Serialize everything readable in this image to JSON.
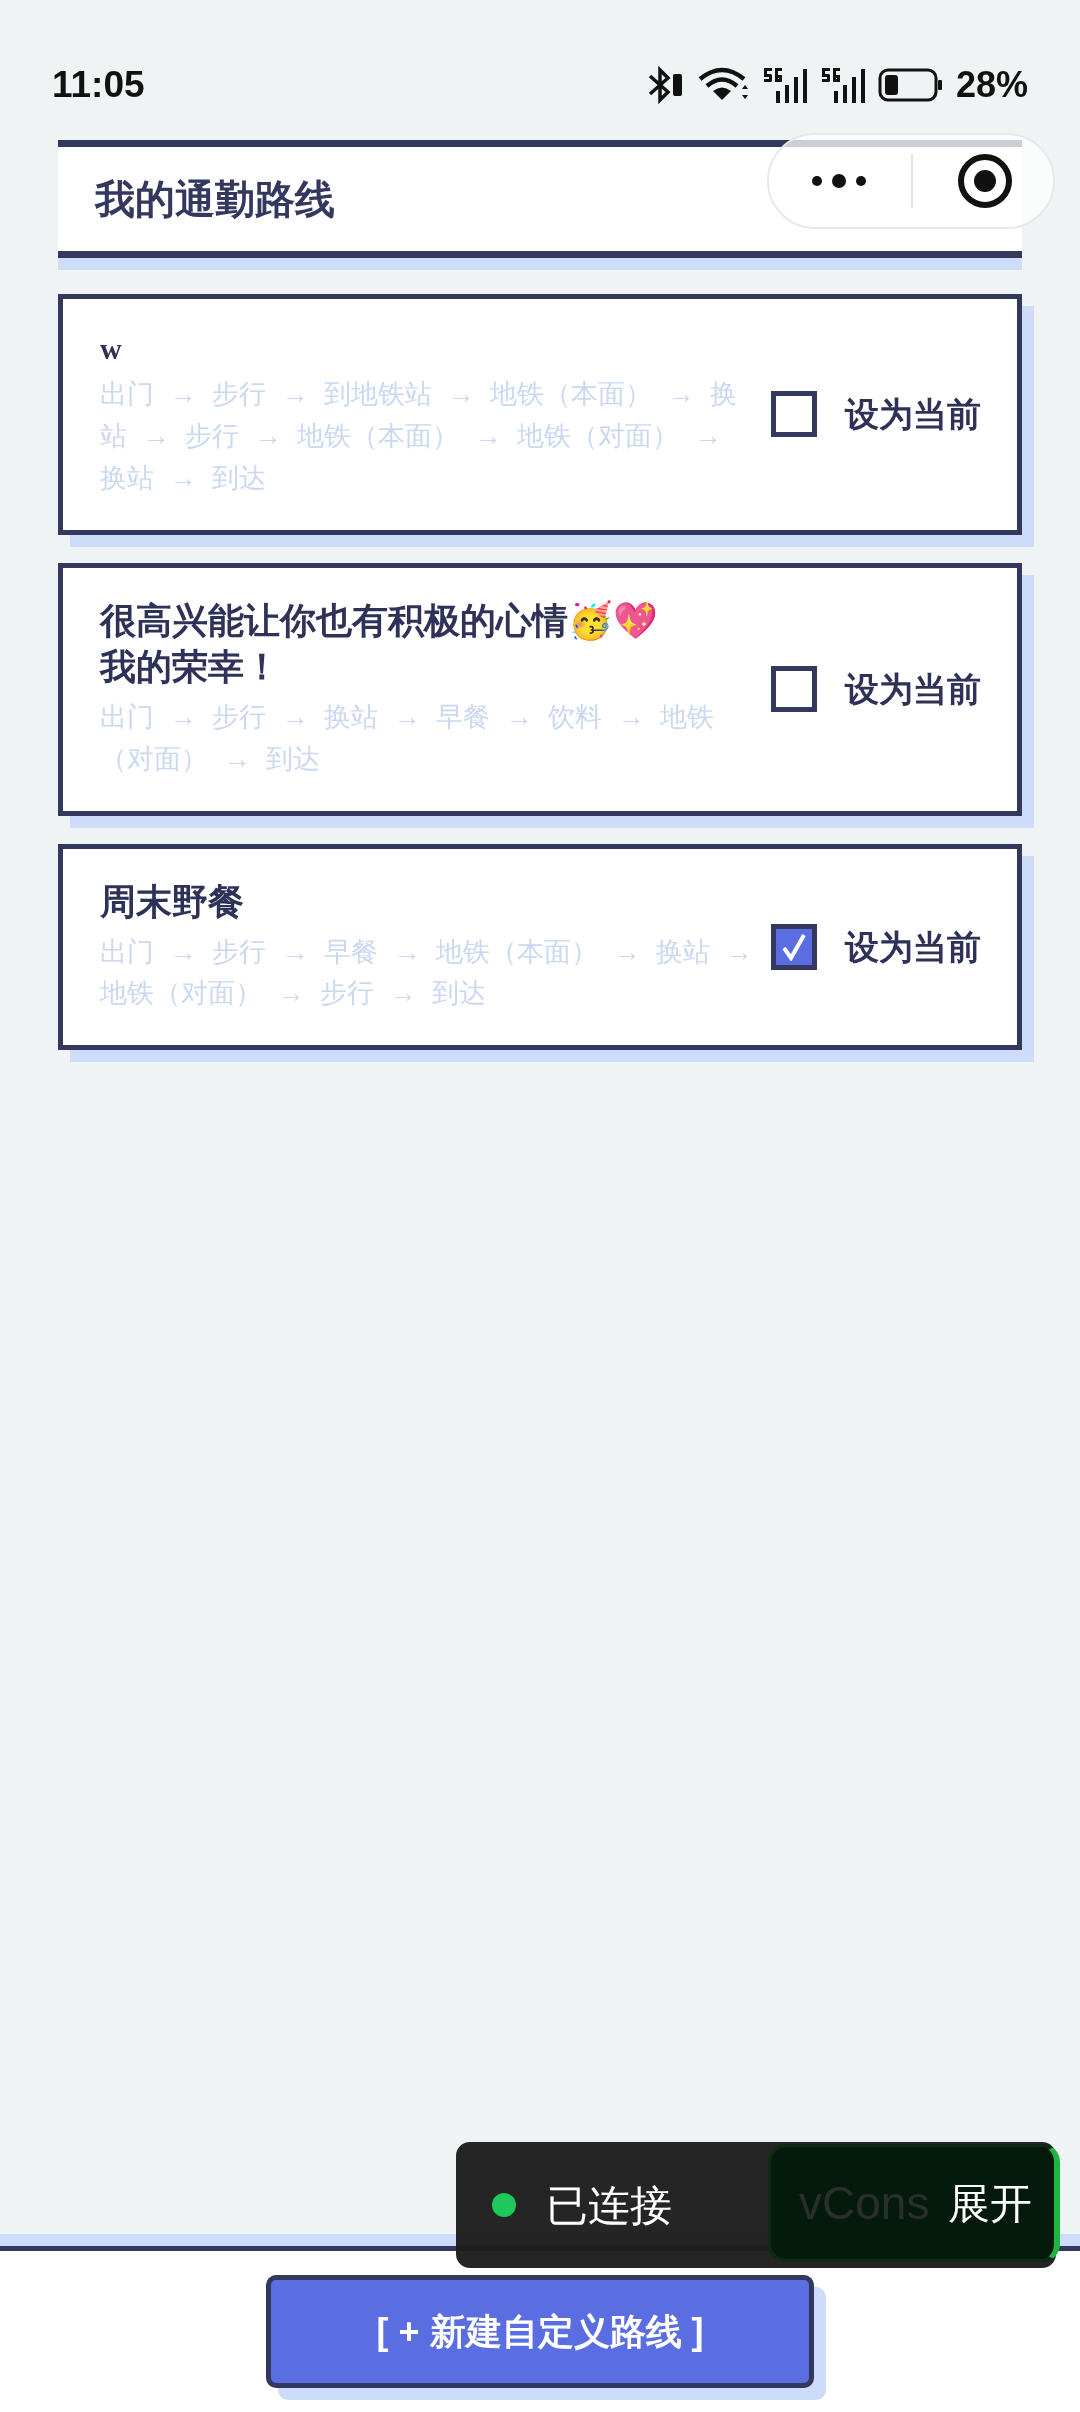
{
  "status_bar": {
    "time": "11:05",
    "battery": "28%"
  },
  "header": {
    "title": "我的通勤路线"
  },
  "routes": [
    {
      "kind": "serif-title",
      "title": "w",
      "route": "出门 → 步行 → 到地铁站 → 地铁（本面） → 换站 → 步行 → 地铁（本面） → 地铁（对面） → 换站 → 到达",
      "selected": false,
      "toggle_label": "设为当前"
    },
    {
      "kind": "sans-title",
      "title": "很高兴能让你也有积极的心情🥳💖\n我的荣幸！",
      "route": "出门 → 步行 → 换站 → 早餐 → 饮料 → 地铁（对面） → 到达",
      "selected": false,
      "toggle_label": "设为当前"
    },
    {
      "kind": "sans-title",
      "title": "周末野餐",
      "route": "出门 → 步行 → 早餐 → 地铁（本面） → 换站 → 地铁（对面） → 步行 → 到达",
      "selected": true,
      "toggle_label": "设为当前"
    }
  ],
  "console_toast": {
    "status": "已连接",
    "color": "#1ec85a",
    "vconsole_label": "vCons",
    "expand_label": "展开"
  },
  "add_button": {
    "label": "[ +  新建自定义路线 ]"
  }
}
